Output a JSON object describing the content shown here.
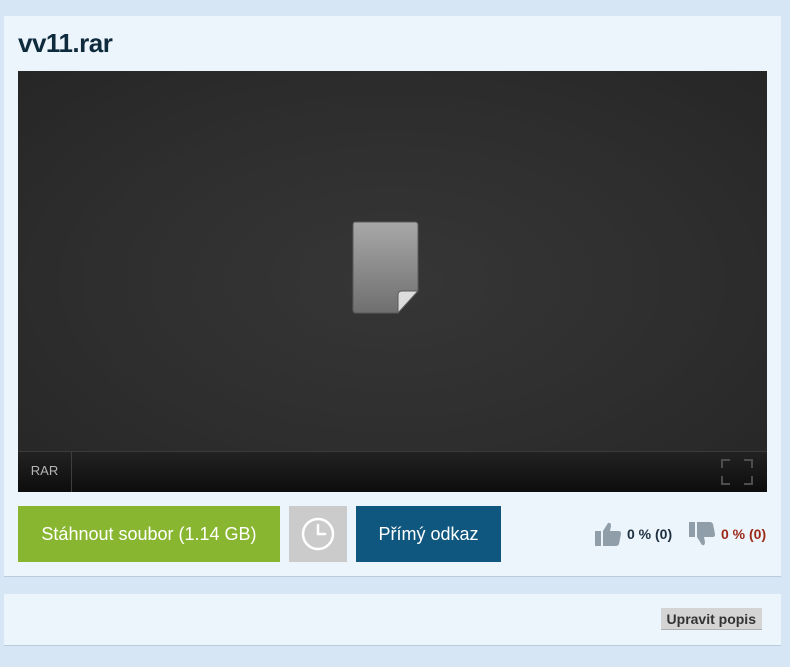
{
  "file": {
    "title": "vv11.rar",
    "type_label": "RAR"
  },
  "actions": {
    "download_label": "Stáhnout soubor (1.14 GB)",
    "direct_link_label": "Přímý odkaz",
    "later_icon": "clock-icon"
  },
  "rating": {
    "up_text": "0 % (0)",
    "down_text": "0 % (0)"
  },
  "description": {
    "edit_label": "Upravit popis"
  },
  "colors": {
    "download": "#88b630",
    "direct_link": "#0f577e",
    "later": "#cbcbcb",
    "thumb": "#8f9ea9",
    "negative": "#9b2a18"
  }
}
